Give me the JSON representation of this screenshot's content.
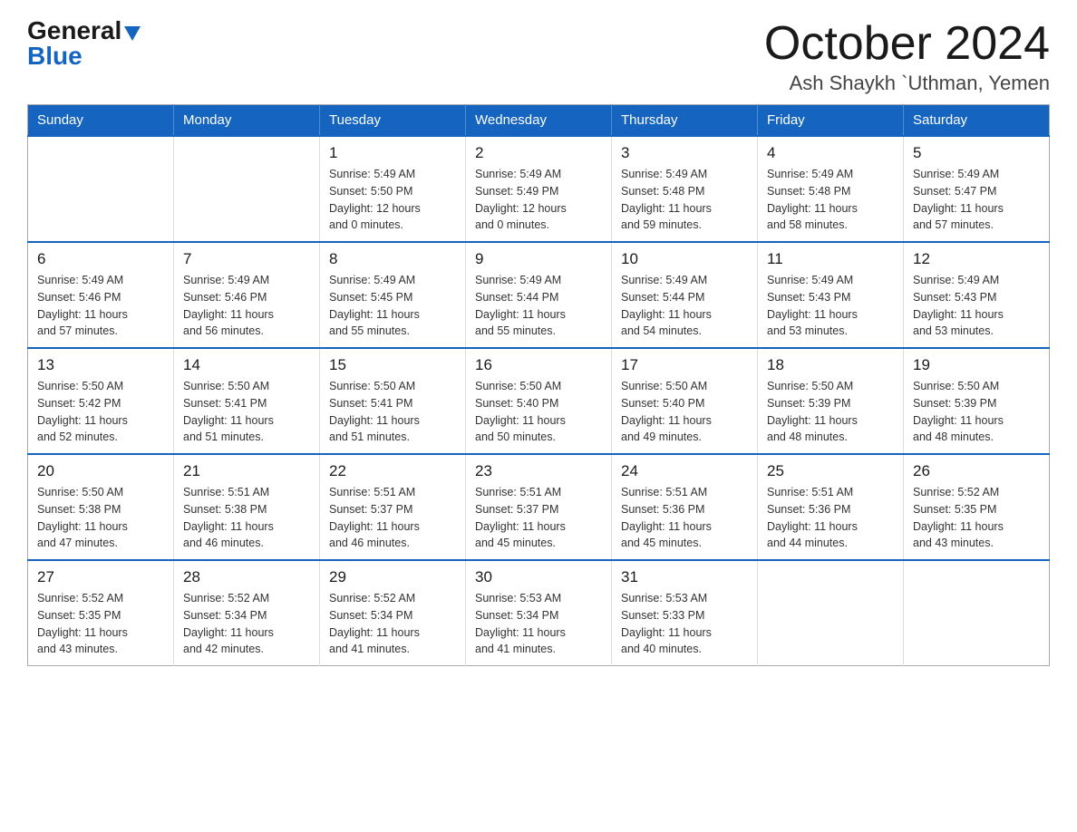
{
  "header": {
    "logo": {
      "general": "General",
      "blue": "Blue",
      "triangle": "▼"
    },
    "title": "October 2024",
    "subtitle": "Ash Shaykh `Uthman, Yemen"
  },
  "calendar": {
    "days_of_week": [
      "Sunday",
      "Monday",
      "Tuesday",
      "Wednesday",
      "Thursday",
      "Friday",
      "Saturday"
    ],
    "weeks": [
      [
        {
          "day": "",
          "info": ""
        },
        {
          "day": "",
          "info": ""
        },
        {
          "day": "1",
          "info": "Sunrise: 5:49 AM\nSunset: 5:50 PM\nDaylight: 12 hours\nand 0 minutes."
        },
        {
          "day": "2",
          "info": "Sunrise: 5:49 AM\nSunset: 5:49 PM\nDaylight: 12 hours\nand 0 minutes."
        },
        {
          "day": "3",
          "info": "Sunrise: 5:49 AM\nSunset: 5:48 PM\nDaylight: 11 hours\nand 59 minutes."
        },
        {
          "day": "4",
          "info": "Sunrise: 5:49 AM\nSunset: 5:48 PM\nDaylight: 11 hours\nand 58 minutes."
        },
        {
          "day": "5",
          "info": "Sunrise: 5:49 AM\nSunset: 5:47 PM\nDaylight: 11 hours\nand 57 minutes."
        }
      ],
      [
        {
          "day": "6",
          "info": "Sunrise: 5:49 AM\nSunset: 5:46 PM\nDaylight: 11 hours\nand 57 minutes."
        },
        {
          "day": "7",
          "info": "Sunrise: 5:49 AM\nSunset: 5:46 PM\nDaylight: 11 hours\nand 56 minutes."
        },
        {
          "day": "8",
          "info": "Sunrise: 5:49 AM\nSunset: 5:45 PM\nDaylight: 11 hours\nand 55 minutes."
        },
        {
          "day": "9",
          "info": "Sunrise: 5:49 AM\nSunset: 5:44 PM\nDaylight: 11 hours\nand 55 minutes."
        },
        {
          "day": "10",
          "info": "Sunrise: 5:49 AM\nSunset: 5:44 PM\nDaylight: 11 hours\nand 54 minutes."
        },
        {
          "day": "11",
          "info": "Sunrise: 5:49 AM\nSunset: 5:43 PM\nDaylight: 11 hours\nand 53 minutes."
        },
        {
          "day": "12",
          "info": "Sunrise: 5:49 AM\nSunset: 5:43 PM\nDaylight: 11 hours\nand 53 minutes."
        }
      ],
      [
        {
          "day": "13",
          "info": "Sunrise: 5:50 AM\nSunset: 5:42 PM\nDaylight: 11 hours\nand 52 minutes."
        },
        {
          "day": "14",
          "info": "Sunrise: 5:50 AM\nSunset: 5:41 PM\nDaylight: 11 hours\nand 51 minutes."
        },
        {
          "day": "15",
          "info": "Sunrise: 5:50 AM\nSunset: 5:41 PM\nDaylight: 11 hours\nand 51 minutes."
        },
        {
          "day": "16",
          "info": "Sunrise: 5:50 AM\nSunset: 5:40 PM\nDaylight: 11 hours\nand 50 minutes."
        },
        {
          "day": "17",
          "info": "Sunrise: 5:50 AM\nSunset: 5:40 PM\nDaylight: 11 hours\nand 49 minutes."
        },
        {
          "day": "18",
          "info": "Sunrise: 5:50 AM\nSunset: 5:39 PM\nDaylight: 11 hours\nand 48 minutes."
        },
        {
          "day": "19",
          "info": "Sunrise: 5:50 AM\nSunset: 5:39 PM\nDaylight: 11 hours\nand 48 minutes."
        }
      ],
      [
        {
          "day": "20",
          "info": "Sunrise: 5:50 AM\nSunset: 5:38 PM\nDaylight: 11 hours\nand 47 minutes."
        },
        {
          "day": "21",
          "info": "Sunrise: 5:51 AM\nSunset: 5:38 PM\nDaylight: 11 hours\nand 46 minutes."
        },
        {
          "day": "22",
          "info": "Sunrise: 5:51 AM\nSunset: 5:37 PM\nDaylight: 11 hours\nand 46 minutes."
        },
        {
          "day": "23",
          "info": "Sunrise: 5:51 AM\nSunset: 5:37 PM\nDaylight: 11 hours\nand 45 minutes."
        },
        {
          "day": "24",
          "info": "Sunrise: 5:51 AM\nSunset: 5:36 PM\nDaylight: 11 hours\nand 45 minutes."
        },
        {
          "day": "25",
          "info": "Sunrise: 5:51 AM\nSunset: 5:36 PM\nDaylight: 11 hours\nand 44 minutes."
        },
        {
          "day": "26",
          "info": "Sunrise: 5:52 AM\nSunset: 5:35 PM\nDaylight: 11 hours\nand 43 minutes."
        }
      ],
      [
        {
          "day": "27",
          "info": "Sunrise: 5:52 AM\nSunset: 5:35 PM\nDaylight: 11 hours\nand 43 minutes."
        },
        {
          "day": "28",
          "info": "Sunrise: 5:52 AM\nSunset: 5:34 PM\nDaylight: 11 hours\nand 42 minutes."
        },
        {
          "day": "29",
          "info": "Sunrise: 5:52 AM\nSunset: 5:34 PM\nDaylight: 11 hours\nand 41 minutes."
        },
        {
          "day": "30",
          "info": "Sunrise: 5:53 AM\nSunset: 5:34 PM\nDaylight: 11 hours\nand 41 minutes."
        },
        {
          "day": "31",
          "info": "Sunrise: 5:53 AM\nSunset: 5:33 PM\nDaylight: 11 hours\nand 40 minutes."
        },
        {
          "day": "",
          "info": ""
        },
        {
          "day": "",
          "info": ""
        }
      ]
    ]
  }
}
